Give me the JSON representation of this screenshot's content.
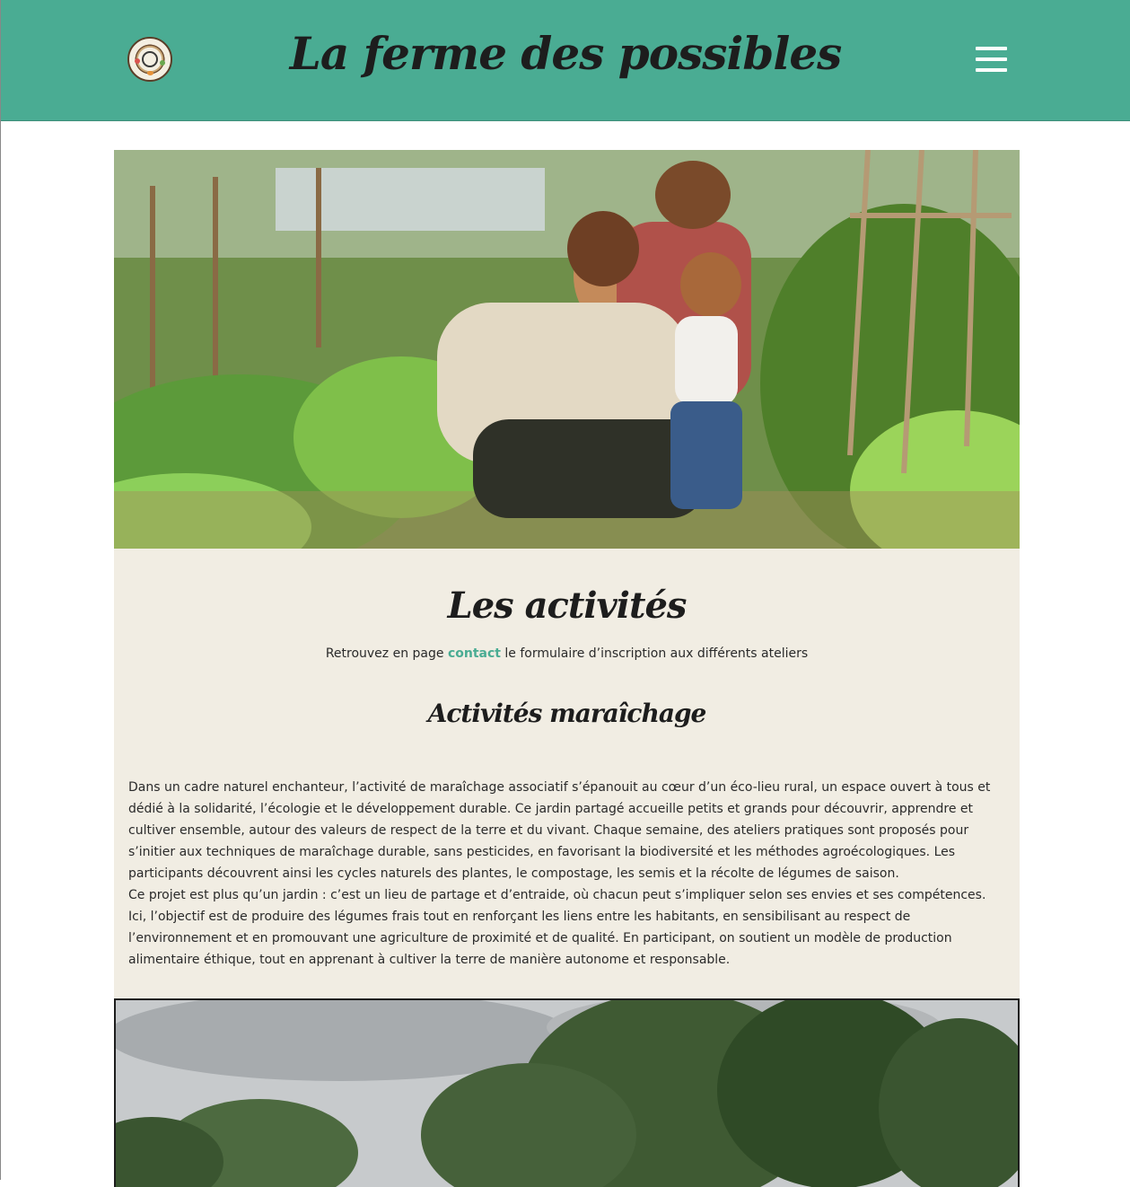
{
  "header": {
    "site_title": "La ferme des possibles",
    "background_color": "#4aac93",
    "logo_icon": "sewing-machine-logo-icon",
    "menu_icon": "hamburger-menu-icon"
  },
  "hero_image": {
    "description_icon": "family-garden-photo"
  },
  "main": {
    "title": "Les activités",
    "intro_before": "Retrouvez en page ",
    "intro_link": "contact",
    "intro_after": " le formulaire d’inscription aux différents ateliers",
    "section_title": "Activités maraîchage",
    "paragraph_1": "Dans un cadre naturel enchanteur, l’activité de maraîchage associatif s’épanouit au cœur d’un éco-lieu rural, un espace ouvert à tous et dédié à la solidarité, l’écologie et le développement durable. Ce jardin partagé accueille petits et grands pour découvrir, apprendre et cultiver ensemble, autour des valeurs de respect de la terre et du vivant. Chaque semaine, des ateliers pratiques sont proposés pour s’initier aux techniques de maraîchage durable, sans pesticides, en favorisant la biodiversité et les méthodes agroécologiques. Les participants découvrent ainsi les cycles naturels des plantes, le compostage, les semis et la récolte de légumes de saison.",
    "paragraph_2": "Ce projet est plus qu’un jardin : c’est un lieu de partage et d’entraide, où chacun peut s’impliquer selon ses envies et ses compétences. Ici, l’objectif est de produire des légumes frais tout en renforçant les liens entre les habitants, en sensibilisant au respect de l’environnement et en promouvant une agriculture de proximité et de qualité. En participant, on soutient un modèle de production alimentaire éthique, tout en apprenant à cultiver la terre de manière autonome et responsable.",
    "link_color": "#4aac93",
    "panel_color": "#f1ede3"
  },
  "second_image": {
    "description_icon": "trees-sky-photo"
  }
}
